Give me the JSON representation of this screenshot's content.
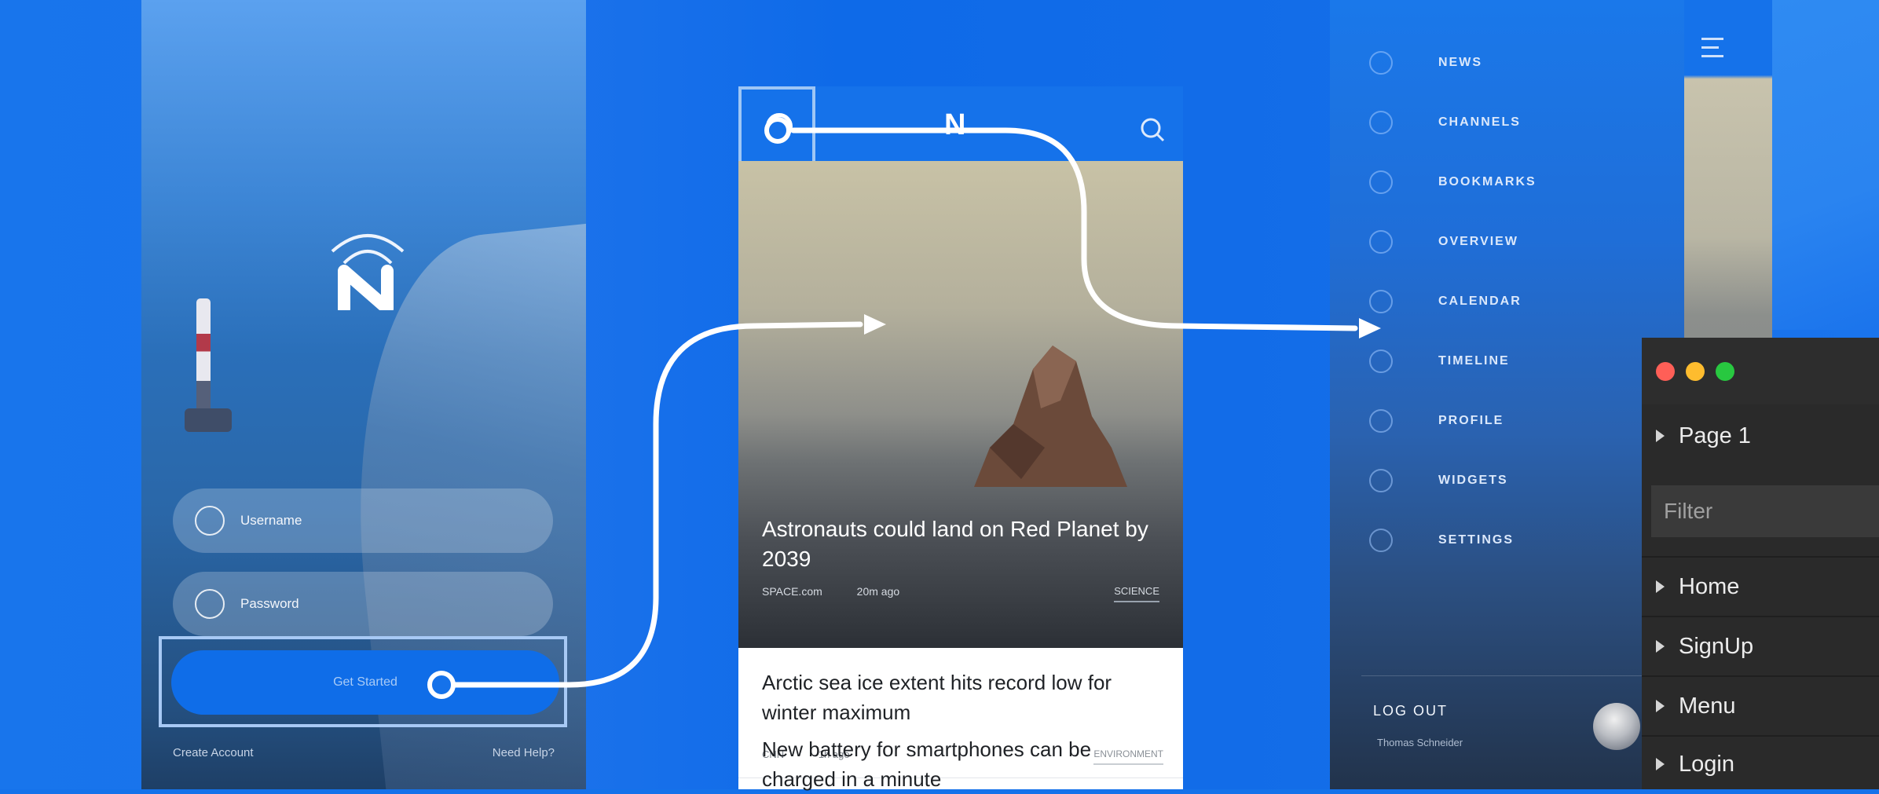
{
  "login_screen": {
    "username_placeholder": "Username",
    "password_placeholder": "Password",
    "get_started_label": "Get Started",
    "create_account_label": "Create Account",
    "need_help_label": "Need Help?"
  },
  "news_screen": {
    "logo_letter": "N",
    "hero": {
      "title": "Astronauts could land on Red Planet by 2039",
      "source": "SPACE.com",
      "time": "20m ago",
      "tag": "SCIENCE"
    },
    "articles": [
      {
        "title": "Arctic sea ice extent hits record low for winter maximum",
        "source": "CNN",
        "time": "1h ago",
        "tag": "ENVIRONMENT"
      },
      {
        "title": "New battery for smartphones can be charged in a minute"
      }
    ]
  },
  "menu_screen": {
    "items": [
      {
        "label": "NEWS",
        "icon": "list-icon"
      },
      {
        "label": "CHANNELS",
        "icon": "grid-icon"
      },
      {
        "label": "BOOKMARKS",
        "icon": "bookmark-icon"
      },
      {
        "label": "OVERVIEW",
        "icon": "gauge-icon"
      },
      {
        "label": "CALENDAR",
        "icon": "calendar-icon"
      },
      {
        "label": "TIMELINE",
        "icon": "stopwatch-icon"
      },
      {
        "label": "PROFILE",
        "icon": "user-icon"
      },
      {
        "label": "WIDGETS",
        "icon": "check-circle-icon"
      },
      {
        "label": "SETTINGS",
        "icon": "gear-icon"
      }
    ],
    "logout_label": "LOG OUT",
    "user_name": "Thomas Schneider"
  },
  "panel": {
    "page_label": "Page 1",
    "filter_placeholder": "Filter",
    "items": [
      "Home",
      "SignUp",
      "Menu",
      "Login"
    ],
    "colors": {
      "close": "#ff5f57",
      "minimize": "#febc2e",
      "zoom": "#28c840"
    }
  }
}
